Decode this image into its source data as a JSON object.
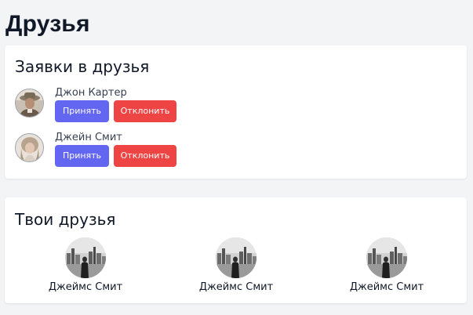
{
  "page": {
    "title": "Друзья"
  },
  "requests": {
    "title": "Заявки в друзья",
    "accept_label": "Принять",
    "decline_label": "Отклонить",
    "items": [
      {
        "name": "Джон Картер",
        "avatar": "man-with-hat-portrait"
      },
      {
        "name": "Джейн Смит",
        "avatar": "woman-portrait"
      }
    ]
  },
  "friends": {
    "title": "Твои друзья",
    "items": [
      {
        "name": "Джеймс Смит",
        "avatar": "city-skyline-photo"
      },
      {
        "name": "Джеймс Смит",
        "avatar": "city-skyline-photo"
      },
      {
        "name": "Джеймс Смит",
        "avatar": "city-skyline-photo"
      }
    ]
  },
  "colors": {
    "background": "#f3f4f6",
    "card": "#ffffff",
    "accept": "#6366f1",
    "decline": "#ef4444"
  }
}
